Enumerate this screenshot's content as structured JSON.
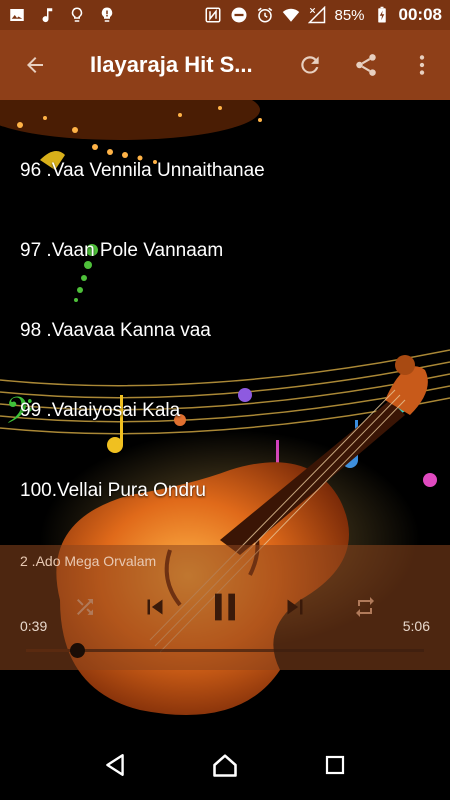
{
  "status_bar": {
    "battery": "85%",
    "time": "00:08",
    "left_icons": [
      "image-icon",
      "music-note-icon",
      "lightbulb-icon",
      "lightbulb-alert-icon"
    ],
    "right_icons": [
      "nfc-icon",
      "do-not-disturb-icon",
      "alarm-icon",
      "wifi-icon",
      "signal-icon",
      "battery-charging-icon"
    ]
  },
  "app_bar": {
    "title": "Ilayaraja Hit S...",
    "background": "#8e3f18"
  },
  "songs": [
    "96 .Vaa Vennila Unnaithanae",
    "97 .Vaan Pole Vannaam",
    "98 .Vaavaa Kanna vaa",
    "99 .Valaiyosai Kala",
    "100.Vellai Pura Ondru"
  ],
  "player": {
    "now_playing": "2  .Ado Mega Orvalam",
    "elapsed": "0:39",
    "duration": "5:06",
    "progress_fraction": 0.127
  }
}
